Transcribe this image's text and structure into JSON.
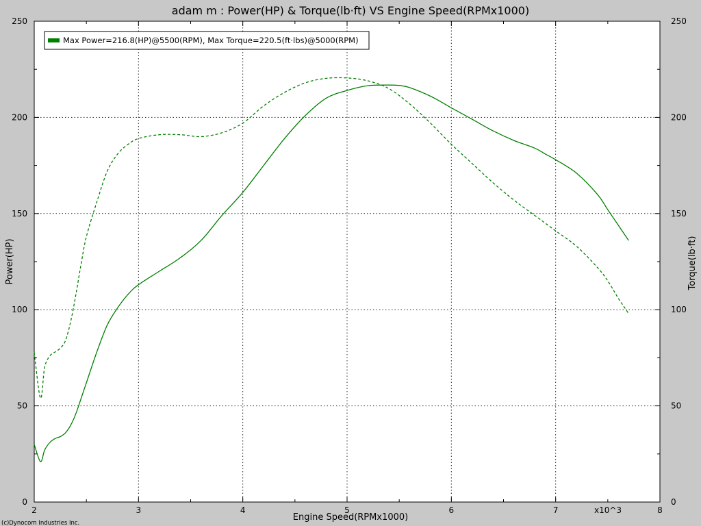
{
  "chart_data": {
    "type": "line",
    "title": "adam m : Power(HP) & Torque(lb·ft) VS Engine Speed(RPMx1000)",
    "xlabel": "Engine Speed(RPMx1000)",
    "ylabel": "Power(HP)",
    "y2label": "Torque(lb·ft)",
    "x_multiplier_label": "x10^3",
    "xlim": [
      2,
      8
    ],
    "ylim": [
      0,
      250
    ],
    "y2lim": [
      0,
      250
    ],
    "x_ticks": [
      "2",
      "3",
      "4",
      "5",
      "6",
      "7",
      "8"
    ],
    "y_ticks": [
      "0",
      "50",
      "100",
      "150",
      "200",
      "250"
    ],
    "y2_ticks": [
      "0",
      "50",
      "100",
      "150",
      "200",
      "250"
    ],
    "grid": true,
    "legend_position": "top-left",
    "legend_text": "Max Power=216.8(HP)@5500(RPM), Max Torque=220.5(ft·lbs)@5000(RPM)",
    "line_color": "#008000",
    "series": [
      {
        "style": "solid",
        "axis": "left",
        "x": [
          2.0,
          2.06,
          2.1,
          2.15,
          2.2,
          2.25,
          2.3,
          2.35,
          2.4,
          2.45,
          2.5,
          2.6,
          2.7,
          2.8,
          2.9,
          3.0,
          3.2,
          3.4,
          3.6,
          3.8,
          4.0,
          4.2,
          4.4,
          4.6,
          4.8,
          5.0,
          5.2,
          5.4,
          5.5,
          5.6,
          5.8,
          6.0,
          6.2,
          6.4,
          6.6,
          6.8,
          6.9,
          7.0,
          7.2,
          7.4,
          7.5,
          7.6,
          7.65,
          7.7
        ],
        "y": [
          30,
          21,
          27,
          31,
          33,
          34,
          36,
          40,
          46,
          54,
          62,
          78,
          92,
          101,
          108,
          113,
          120,
          127,
          136,
          149,
          161,
          175,
          189,
          201,
          210,
          214,
          216.5,
          216.8,
          216.6,
          215.5,
          211,
          205,
          199,
          193,
          188,
          184,
          181,
          178,
          171,
          160,
          152,
          144,
          140,
          136
        ]
      },
      {
        "style": "dashed",
        "axis": "right",
        "x": [
          2.0,
          2.06,
          2.1,
          2.15,
          2.2,
          2.25,
          2.3,
          2.35,
          2.4,
          2.45,
          2.5,
          2.6,
          2.7,
          2.8,
          2.9,
          3.0,
          3.2,
          3.4,
          3.6,
          3.8,
          4.0,
          4.2,
          4.4,
          4.6,
          4.8,
          5.0,
          5.2,
          5.4,
          5.6,
          5.8,
          6.0,
          6.2,
          6.4,
          6.6,
          6.8,
          7.0,
          7.2,
          7.4,
          7.5,
          7.6,
          7.65,
          7.7
        ],
        "y": [
          78,
          54,
          70,
          76,
          78,
          80,
          84,
          94,
          108,
          124,
          138,
          156,
          172,
          181,
          186,
          189,
          191,
          191,
          190,
          192,
          197,
          206,
          213,
          218,
          220.3,
          220.5,
          219,
          215,
          207,
          197,
          186,
          176,
          166,
          157,
          149,
          141,
          133,
          122,
          115,
          106,
          102,
          98
        ]
      }
    ]
  },
  "footer": {
    "copyright": "(c)Dynocom Industries Inc."
  }
}
